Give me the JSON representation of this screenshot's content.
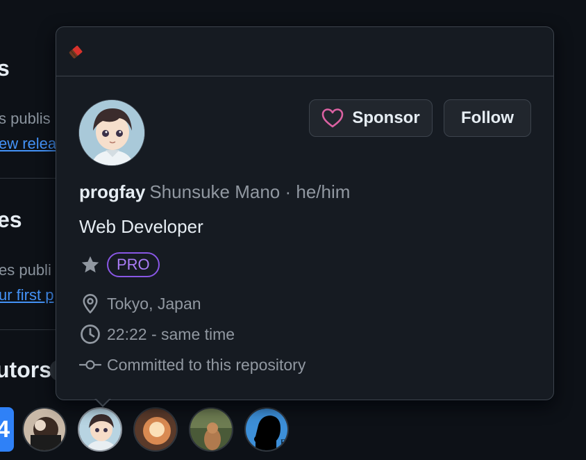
{
  "background": {
    "releases_heading": "s",
    "releases_text": "s publis",
    "releases_link": "ew relea",
    "packages_heading": "es",
    "packages_text": "es publi",
    "packages_link": "ur first p",
    "contributors_heading": "utors",
    "contributors_count_partial": "4"
  },
  "hovercard": {
    "login": "progfay",
    "full_name": "Shunsuke Mano · he/him",
    "bio": "Web Developer",
    "pro_label": "PRO",
    "location": "Tokyo, Japan",
    "local_time": "22:22 - same time",
    "commit_note": "Committed to this repository",
    "sponsor_label": "Sponsor",
    "follow_label": "Follow"
  },
  "colors": {
    "page_bg": "#0d1117",
    "card_bg": "#161b22",
    "border": "#3d444d",
    "muted_text": "#9198a1",
    "link": "#4493f8",
    "sponsor_heart": "#db61a2",
    "pro_purple": "#8957e5"
  },
  "icons": {
    "status_emoji": "chocolate-bar",
    "sponsor": "heart-icon",
    "pro": "star-icon",
    "location": "location-pin-icon",
    "time": "clock-icon",
    "commit": "git-commit-icon"
  }
}
